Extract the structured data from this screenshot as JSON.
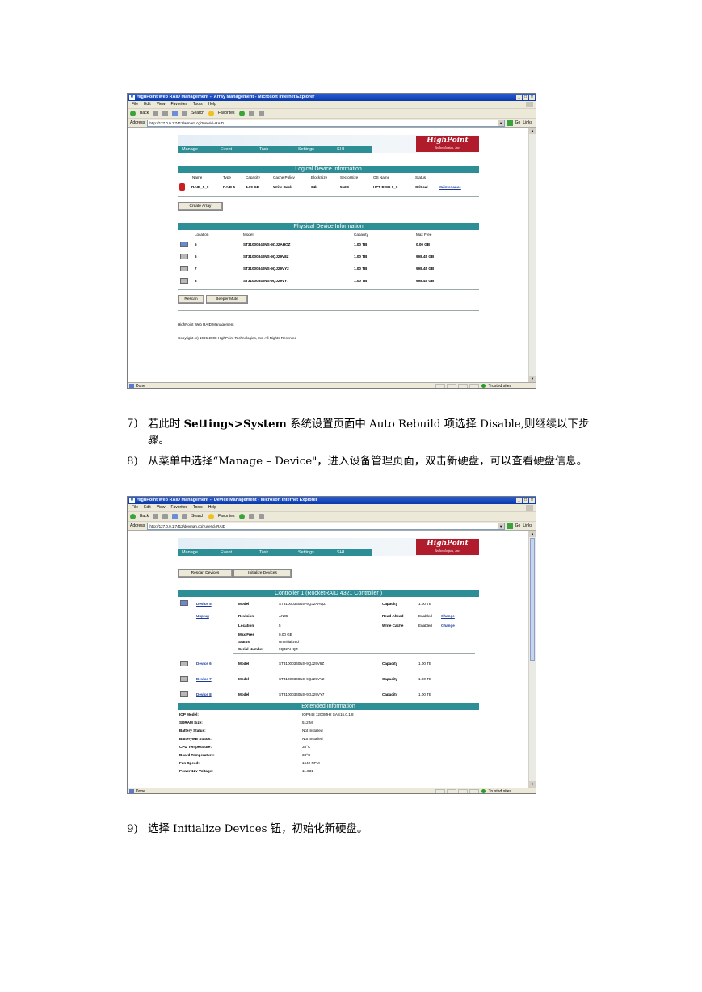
{
  "screenshot1": {
    "window_title": "HighPoint Web RAID Management -- Array Management - Microsoft Internet Explorer",
    "menu": [
      "File",
      "Edit",
      "View",
      "Favorites",
      "Tools",
      "Help"
    ],
    "toolbar": {
      "back": "Back",
      "search": "Search",
      "favorites": "Favorites"
    },
    "address_label": "Address",
    "address_url": "http://127.0.0.1:7412/armam.cgi?userid=RAID",
    "go_label": "Go",
    "links_label": "Links",
    "nav": [
      "Manage",
      "Event",
      "Task",
      "Settings",
      "SHI"
    ],
    "logo": {
      "main": "HighPoint",
      "sub": "Technologies, Inc."
    },
    "logical_header": "Logical Device Information",
    "logical_columns": [
      "Name",
      "Type",
      "Capacity",
      "Cache Policy",
      "BlockSize",
      "SectorSize",
      "OS Name",
      "Status"
    ],
    "logical_row": {
      "name": "RAID_5_0",
      "type": "RAID 5",
      "capacity": "4.99 GB",
      "cache_policy": "Write Back",
      "block_size": "64k",
      "sector_size": "512B",
      "os_name": "HPT DISK 0_0",
      "status": "Critical",
      "action": "Maintenance"
    },
    "create_array_button": "Create Array",
    "physical_header": "Physical Device Information",
    "physical_columns": [
      "Location",
      "Model",
      "Capacity",
      "Max Free"
    ],
    "physical_rows": [
      {
        "location": "5",
        "model": "ST31000340NS-9QJ2AHQZ",
        "capacity": "1.00 TB",
        "max_free": "0.00 GB"
      },
      {
        "location": "6",
        "model": "ST31000340NS-9QJ29V8Z",
        "capacity": "1.00 TB",
        "max_free": "998.45 GB"
      },
      {
        "location": "7",
        "model": "ST31000340NS-9QJ29VY2",
        "capacity": "1.00 TB",
        "max_free": "998.45 GB"
      },
      {
        "location": "8",
        "model": "ST31000340NS-9QJ29VY7",
        "capacity": "1.00 TB",
        "max_free": "998.45 GB"
      }
    ],
    "rescan_button": "Rescan",
    "beeper_button": "Beeper Mute",
    "footer_title": "HighPoint Web RAID Management",
    "footer_copyright": "Copyright (c) 1996-2008 HighPoint Technologies, Inc. All Rights Reserved",
    "status_text": "Done",
    "zone_text": "Trusted sites"
  },
  "paragraphs": [
    {
      "num": "7)",
      "before": "若此时 ",
      "bold": "Settings>System",
      "after": " 系统设置页面中 Auto Rebuild 项选择 Disable,则继续以下步骤。"
    },
    {
      "num": "8)",
      "text": "从菜单中选择“Manage – Device\"，进入设备管理页面，双击新硬盘，可以查看硬盘信息。"
    },
    {
      "num": "9)",
      "text": "选择 Initialize Devices 钮，初始化新硬盘。"
    }
  ],
  "screenshot2": {
    "window_title": "HighPoint Web RAID Management -- Device Management - Microsoft Internet Explorer",
    "menu": [
      "File",
      "Edit",
      "View",
      "Favorites",
      "Tools",
      "Help"
    ],
    "toolbar": {
      "back": "Back",
      "search": "Search",
      "favorites": "Favorites"
    },
    "address_label": "Address",
    "address_url": "http://127.0.0.1:7412/devman.cgi?userid=RAID",
    "go_label": "Go",
    "links_label": "Links",
    "nav": [
      "Manage",
      "Event",
      "Task",
      "Settings",
      "SHI"
    ],
    "logo": {
      "main": "HighPoint",
      "sub": "Technologies, Inc."
    },
    "rescan_devices_button": "Rescan Devices",
    "initialize_devices_button": "Initialize Devices",
    "controller_header": "Controller 1 (RocketRAID 4321 Controller   )",
    "device5": {
      "link": "Device 5",
      "unplug": "Unplug",
      "fields": [
        {
          "label": "Model",
          "value": "ST31000340NS-9QJ2AHQZ"
        },
        {
          "label": "Revision",
          "value": "AN05"
        },
        {
          "label": "Location",
          "value": "5"
        },
        {
          "label": "Max Free",
          "value": "0.00 GB"
        },
        {
          "label": "Status",
          "value": "Uninitialized"
        },
        {
          "label": "Serial Number",
          "value": "9QJ2AHQZ"
        }
      ],
      "capacity_label": "Capacity",
      "capacity": "1.00 TB",
      "read_ahead_label": "Read Ahead",
      "read_ahead": "Enabled",
      "write_cache_label": "Write Cache",
      "write_cache": "Enabled",
      "change": "Change"
    },
    "other_devices": [
      {
        "link": "Device 6",
        "model_label": "Model",
        "model": "ST31000340NS-9QJ29V8Z",
        "capacity_label": "Capacity",
        "capacity": "1.00 TB"
      },
      {
        "link": "Device 7",
        "model_label": "Model",
        "model": "ST31000340NS-9QJ29VY2",
        "capacity_label": "Capacity",
        "capacity": "1.00 TB"
      },
      {
        "link": "Device 8",
        "model_label": "Model",
        "model": "ST31000340NS-9QJ29VY7",
        "capacity_label": "Capacity",
        "capacity": "1.00 TB"
      }
    ],
    "extended_header": "Extended Information",
    "extended": [
      {
        "label": "IOP Model:",
        "value": "IOP348 1200MHz SAS15.0.1.8"
      },
      {
        "label": "SDRAM Size:",
        "value": "512 M"
      },
      {
        "label": "Battery Status:",
        "value": "Not Installed"
      },
      {
        "label": "BatteryMB Status:",
        "value": "Not Installed"
      },
      {
        "label": "CPU Temperature:",
        "value": "38°C"
      },
      {
        "label": "Board Temperature:",
        "value": "33°C"
      },
      {
        "label": "Fan Speed:",
        "value": "1642 RPM"
      },
      {
        "label": "Power 12v Voltage:",
        "value": "11.931"
      }
    ],
    "status_text": "Done",
    "zone_text": "Trusted sites"
  }
}
